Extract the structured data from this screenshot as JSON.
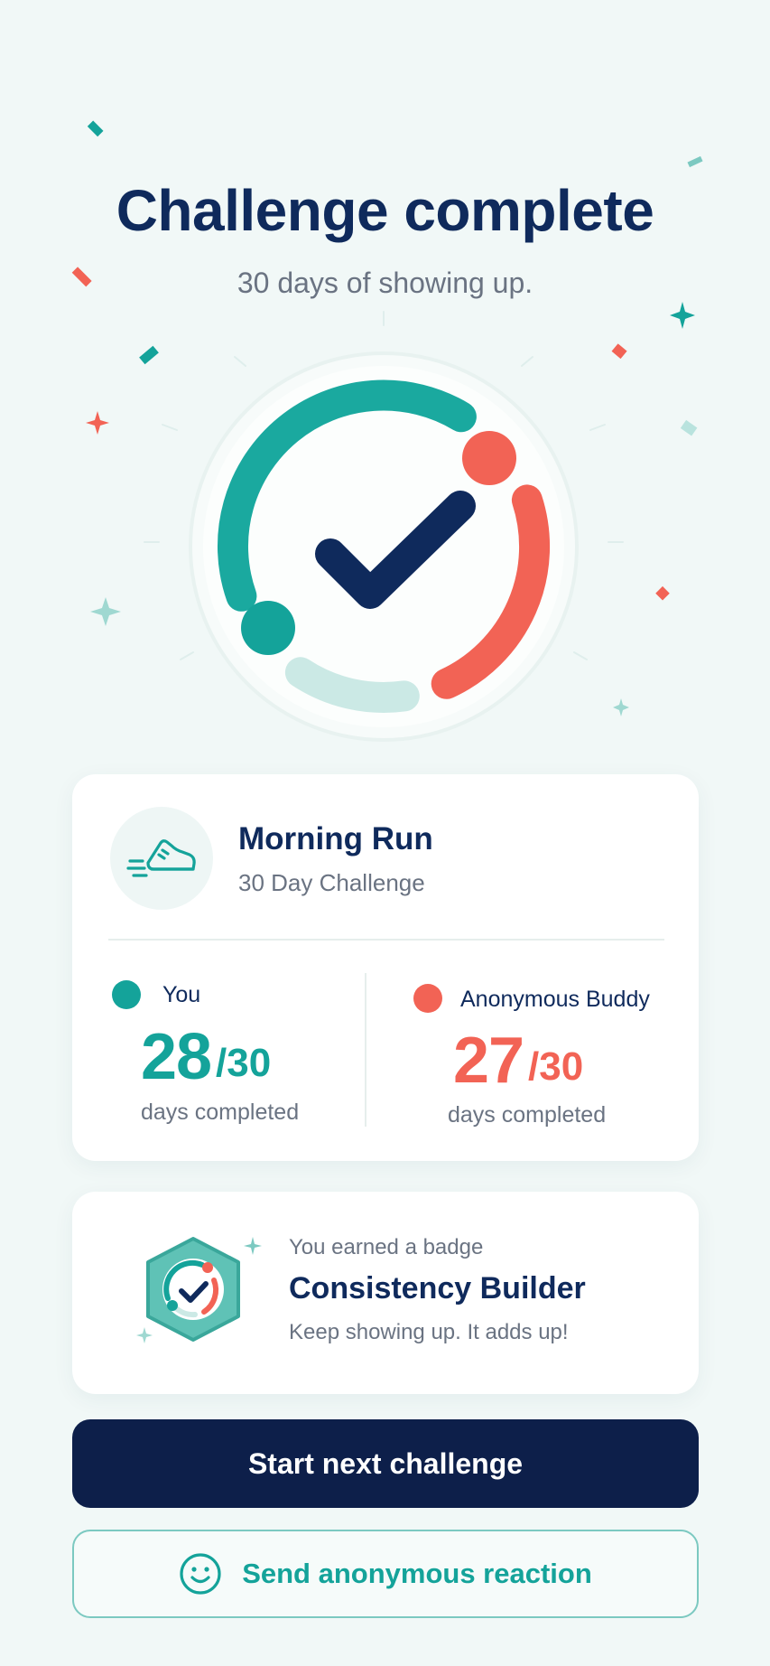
{
  "header": {
    "title": "Challenge complete",
    "subtitle": "30 days of showing up."
  },
  "challenge": {
    "name": "Morning Run",
    "type": "30 Day Challenge",
    "icon": "running-shoe-icon"
  },
  "participants": [
    {
      "name": "You",
      "completed": "28",
      "total": "/30",
      "caption": "days completed",
      "color": "#14a39a"
    },
    {
      "name": "Anonymous Buddy",
      "completed": "27",
      "total": "/30",
      "caption": "days completed",
      "color": "#f26355"
    }
  ],
  "badge": {
    "kicker": "You earned a badge",
    "name": "Consistency Builder",
    "description": "Keep showing up. It adds up!",
    "icon": "checkmark-ring-badge-icon"
  },
  "actions": {
    "primary_label": "Start next challenge",
    "secondary_label": "Send anonymous reaction",
    "secondary_icon": "smiley-face-icon"
  },
  "colors": {
    "navy": "#0f2a5c",
    "teal": "#14a39a",
    "coral": "#f26355",
    "background": "#f1f8f7"
  }
}
